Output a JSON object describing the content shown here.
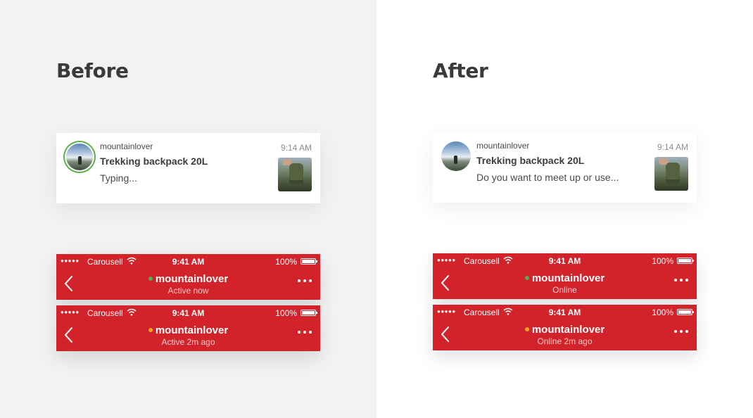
{
  "before": {
    "heading": "Before",
    "card": {
      "username": "mountainlover",
      "title": "Trekking backpack 20L",
      "preview": "Typing...",
      "time": "9:14 AM"
    },
    "bars": [
      {
        "carrier": "Carousell",
        "clock": "9:41 AM",
        "battery": "100%",
        "name": "mountainlover",
        "status": "Active now",
        "dot_color": "#4caf50"
      },
      {
        "carrier": "Carousell",
        "clock": "9:41 AM",
        "battery": "100%",
        "name": "mountainlover",
        "status": "Active 2m ago",
        "dot_color": "#f5a623"
      }
    ]
  },
  "after": {
    "heading": "After",
    "card": {
      "username": "mountainlover",
      "title": "Trekking backpack 20L",
      "preview": "Do you want to meet up or use...",
      "time": "9:14 AM"
    },
    "bars": [
      {
        "carrier": "Carousell",
        "clock": "9:41 AM",
        "battery": "100%",
        "name": "mountainlover",
        "status": "Online",
        "dot_color": "#4caf50"
      },
      {
        "carrier": "Carousell",
        "clock": "9:41 AM",
        "battery": "100%",
        "name": "mountainlover",
        "status": "Online 2m ago",
        "dot_color": "#f5a623"
      }
    ]
  },
  "colors": {
    "bar_red": "#d2232a",
    "avatar_ring_green": "#5cb34a"
  },
  "icons": {
    "signal": "signal-dots-icon",
    "wifi": "wifi-icon",
    "battery": "battery-icon",
    "back": "back-chevron-icon",
    "more": "more-dots-icon",
    "presence": "presence-dot-icon"
  }
}
